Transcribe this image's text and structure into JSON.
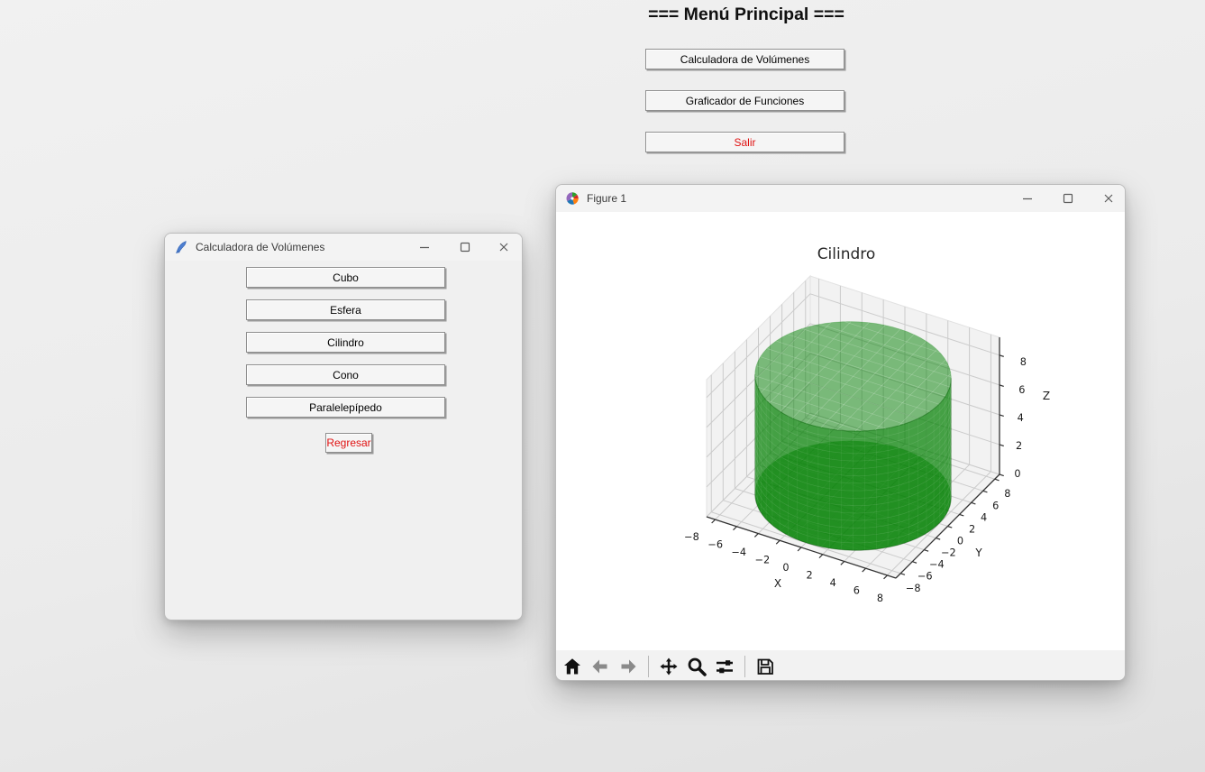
{
  "main_menu": {
    "title": "=== Menú Principal ===",
    "buttons": [
      {
        "label": "Calculadora de Volúmenes",
        "text_color": "#000000"
      },
      {
        "label": "Graficador de Funciones",
        "text_color": "#000000"
      },
      {
        "label": "Salir",
        "text_color": "#e01212"
      }
    ]
  },
  "volume_window": {
    "title": "Calculadora de Volúmenes",
    "shape_buttons": [
      "Cubo",
      "Esfera",
      "Cilindro",
      "Cono",
      "Paralelepípedo"
    ],
    "back_button": {
      "label": "Regresar",
      "text_color": "#e01212"
    }
  },
  "figure_window": {
    "title": "Figure 1",
    "toolbar": [
      "home",
      "back",
      "forward",
      "pan",
      "zoom",
      "configure-subplots",
      "save"
    ]
  },
  "chart_data": {
    "type": "surface",
    "surface_shape": "cylinder",
    "title": "Cilindro",
    "center": [
      0,
      0
    ],
    "radius": 8,
    "height": [
      0,
      8
    ],
    "color": "#008000",
    "alpha": 0.6,
    "xlabel": "X",
    "ylabel": "Y",
    "zlabel": "Z",
    "xticks": [
      -8,
      -6,
      -4,
      -2,
      0,
      2,
      4,
      6,
      8
    ],
    "yticks": [
      -8,
      -6,
      -4,
      -2,
      0,
      2,
      4,
      6,
      8
    ],
    "zticks": [
      0,
      2,
      4,
      6,
      8
    ],
    "xlim": [
      -8.8,
      8.8
    ],
    "ylim": [
      -8.8,
      8.8
    ],
    "zlim": [
      0,
      9.2
    ],
    "grid": true,
    "view": {
      "elev": 30,
      "azim": -60
    }
  }
}
